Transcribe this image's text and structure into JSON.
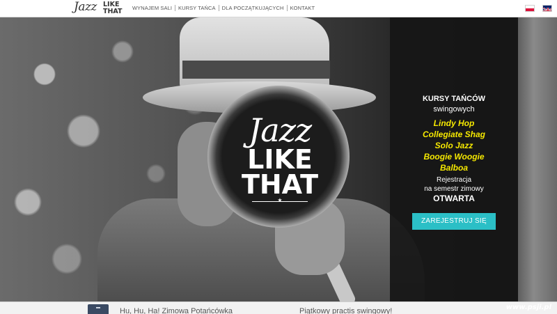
{
  "header": {
    "logo": {
      "jazz": "Jazz",
      "like": "LIKE",
      "that": "THAT"
    },
    "nav": [
      {
        "label": "WYNAJEM SALI"
      },
      {
        "label": "KURSY TAŃCA"
      },
      {
        "label": "DLA POCZĄTKUJĄCYCH"
      },
      {
        "label": "KONTAKT"
      }
    ],
    "languages": [
      {
        "code": "pl",
        "icon": "poland-flag-icon"
      },
      {
        "code": "en",
        "icon": "uk-flag-icon"
      }
    ]
  },
  "hero": {
    "emblem": {
      "jazz": "Jazz",
      "like": "LIKE",
      "that": "THAT",
      "star": "★"
    }
  },
  "promo": {
    "title": "KURSY TAŃCÓW",
    "subtitle": "swingowych",
    "courses": [
      "Lindy Hop",
      "Collegiate Shag",
      "Solo Jazz",
      "Boogie Woogie",
      "Balboa"
    ],
    "registration_line1": "Rejestracja",
    "registration_line2": "na semestr zimowy",
    "status": "OTWARTA",
    "cta": "ZAREJESTRUJ SIĘ",
    "accent": "#2bbfc6",
    "highlight": "#f5e800"
  },
  "news": [
    {
      "title": "Hu, Hu, Ha! Zimowa Potańcówka"
    },
    {
      "title": "Piątkowy practis swingowy!"
    }
  ],
  "watermark": "www.psji.pl"
}
